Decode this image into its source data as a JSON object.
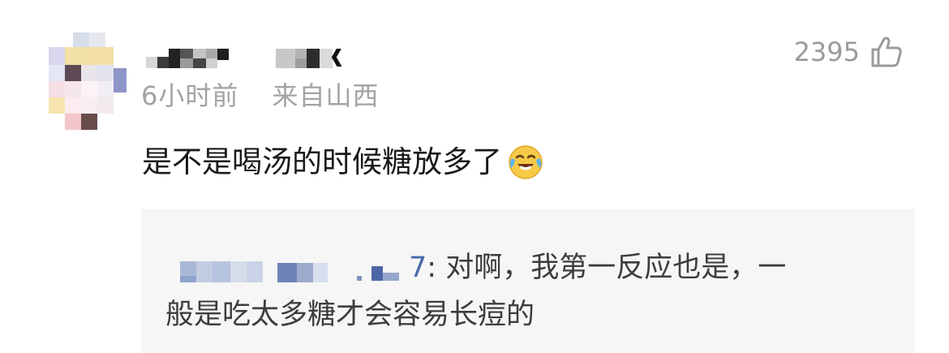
{
  "comment": {
    "time_ago": "6小时前",
    "location": "来自山西",
    "likes_count": "2395",
    "text": "是不是喝汤的时候糖放多了",
    "emoji_icon": "laugh-cry-emoji-icon",
    "like_icon": "thumbs-up-icon"
  },
  "reply": {
    "author_visible_suffix": "7",
    "text_line1": ": 对啊，我第一反应也是，一",
    "text_line2": "般是吃太多糖才会容易长痘的"
  },
  "colors": {
    "meta_text": "#a3a3a3",
    "body_text": "#1a1a1a",
    "reply_bg": "#f6f6f6",
    "reply_name": "#4a6aa8"
  }
}
